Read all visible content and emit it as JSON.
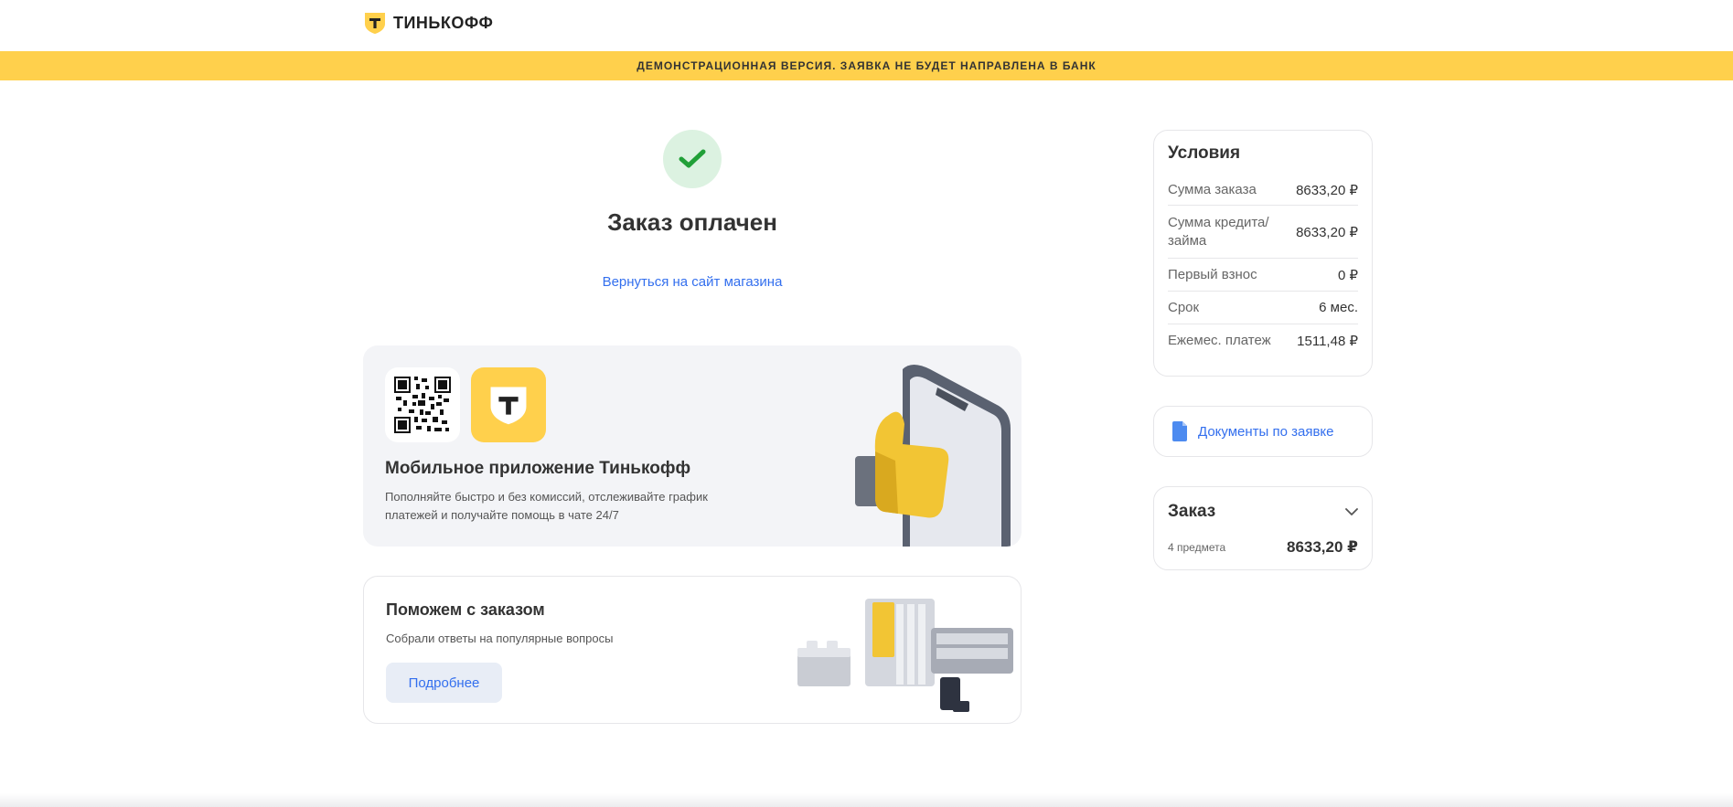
{
  "header": {
    "brand": "ТИНЬКОФФ"
  },
  "banner": {
    "text": "ДЕМОНСТРАЦИОННАЯ ВЕРСИЯ. ЗАЯВКА НЕ БУДЕТ НАПРАВЛЕНА В БАНК"
  },
  "status": {
    "title": "Заказ оплачен",
    "back_link": "Вернуться на сайт магазина"
  },
  "app_promo": {
    "title": "Мобильное приложение Тинькофф",
    "description": "Пополняйте быстро и без комиссий, отслеживайте график платежей и получайте помощь в чате 24/7"
  },
  "help": {
    "title": "Поможем с заказом",
    "description": "Собрали ответы на популярные вопросы",
    "button_label": "Подробнее"
  },
  "terms": {
    "title": "Условия",
    "rows": [
      {
        "label": "Сумма заказа",
        "value": "8633,20 ₽"
      },
      {
        "label": "Сумма кредита/займа",
        "value": "8633,20 ₽"
      },
      {
        "label": "Первый взнос",
        "value": "0 ₽"
      },
      {
        "label": "Срок",
        "value": "6 мес."
      },
      {
        "label": "Ежемес. платеж",
        "value": "1511,48 ₽"
      }
    ]
  },
  "documents": {
    "label": "Документы по заявке"
  },
  "order": {
    "title": "Заказ",
    "items_count": "4 предмета",
    "total": "8633,20 ₽"
  },
  "colors": {
    "brand_yellow": "#ffd04c",
    "link_blue": "#336fee",
    "success_green": "#21a038",
    "text": "#333333"
  },
  "icons": [
    "tinkoff-shield-icon",
    "checkmark-icon",
    "qr-code-icon",
    "document-icon",
    "chevron-down-icon"
  ]
}
